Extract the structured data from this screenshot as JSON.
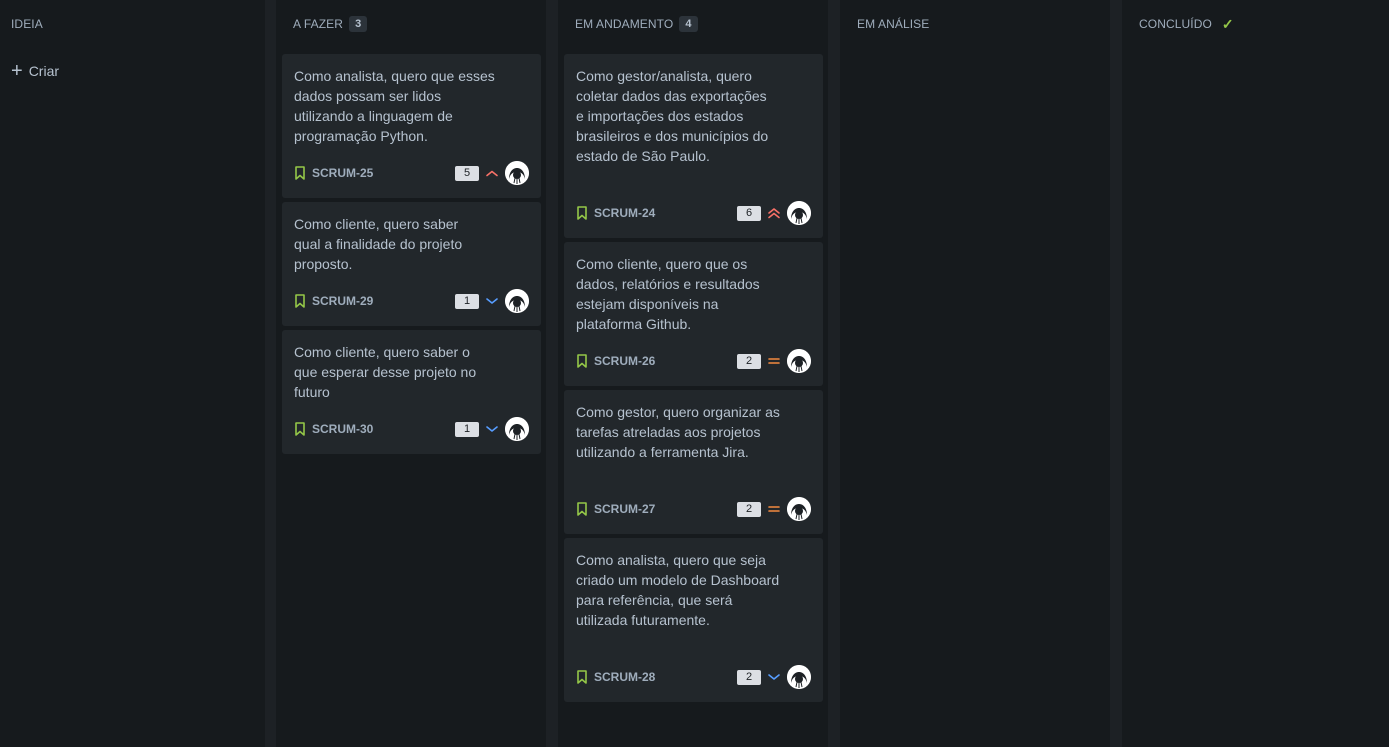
{
  "columns": [
    {
      "title": "IDEIA",
      "count": "",
      "create_label": "Criar"
    },
    {
      "title": "A FAZER",
      "count": "3"
    },
    {
      "title": "EM ANDAMENTO",
      "count": "4"
    },
    {
      "title": "EM ANÁLISE",
      "count": ""
    },
    {
      "title": "CONCLUÍDO",
      "count": ""
    }
  ],
  "cards": {
    "c25": {
      "text": "Como analista, quero que esses dados possam ser lidos utilizando a linguagem de programação Python.",
      "key": "SCRUM-25",
      "points": "5",
      "priority": "high"
    },
    "c29": {
      "text": "Como cliente, quero saber qual a finalidade do projeto proposto.",
      "key": "SCRUM-29",
      "points": "1",
      "priority": "low"
    },
    "c30": {
      "text": "Como cliente, quero saber o que esperar desse projeto no futuro",
      "key": "SCRUM-30",
      "points": "1",
      "priority": "low"
    },
    "c24": {
      "text": "Como gestor/analista, quero coletar dados das exportações e importações dos estados brasileiros e dos municípios do estado de São Paulo.",
      "key": "SCRUM-24",
      "points": "6",
      "priority": "highest"
    },
    "c26": {
      "text": "Como cliente, quero que os dados, relatórios e resultados estejam disponíveis na plataforma Github.",
      "key": "SCRUM-26",
      "points": "2",
      "priority": "medium"
    },
    "c27": {
      "text": "Como gestor, quero organizar as tarefas atreladas aos projetos utilizando a ferramenta Jira.",
      "key": "SCRUM-27",
      "points": "2",
      "priority": "medium"
    },
    "c28": {
      "text": "Como analista, quero que seja criado um modelo de Dashboard para referência, que será utilizada futuramente.",
      "key": "SCRUM-28",
      "points": "2",
      "priority": "low"
    }
  },
  "colors": {
    "background": "#1d2125",
    "column": "#161a1d",
    "card": "#22272b",
    "story_icon": "#94c748",
    "priority_high": "#f87168",
    "priority_medium": "#f38a3f",
    "priority_low": "#579dff"
  }
}
